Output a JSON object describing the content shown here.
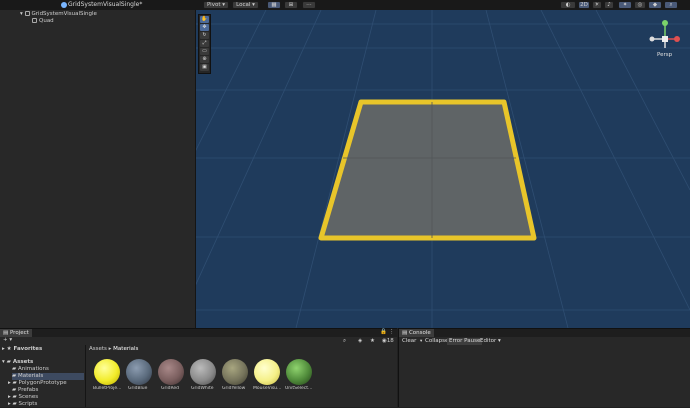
{
  "toolbar": {
    "pivot": "Pivot",
    "local": "Local",
    "mode_2d": "2D",
    "icons": [
      "hand-tool-icon",
      "move-tool-icon",
      "rotate-tool-icon",
      "scale-tool-icon",
      "rect-tool-icon",
      "transform-tool-icon"
    ]
  },
  "hierarchy": {
    "scene_name": "GridSystemVisualSingle*",
    "items": [
      {
        "label": "GridSystemVisualSingle"
      },
      {
        "label": "Quad"
      }
    ]
  },
  "scene": {
    "view_label": "Persp",
    "colors": {
      "background": "#1f3b5c",
      "quad_fill": "#5f6466",
      "quad_border": "#e8c52a"
    }
  },
  "project": {
    "tab": "Project",
    "favorites": "Favorites",
    "assets_root": "Assets",
    "folders": [
      "Animations",
      "Materials",
      "PolygonPrototype",
      "Prefabs",
      "Scenes",
      "Scripts"
    ],
    "breadcrumb": [
      "Assets",
      "Materials"
    ],
    "count": "18",
    "materials": [
      {
        "label": "BulletProje...",
        "color": "#f2ec2a"
      },
      {
        "label": "GridBlue",
        "color": "#5a6a7c"
      },
      {
        "label": "GridRed",
        "color": "#7a5e5e"
      },
      {
        "label": "GridWhite",
        "color": "#8a8a8a"
      },
      {
        "label": "GridYellow",
        "color": "#75735b"
      },
      {
        "label": "MouseVisu...",
        "color": "#f5f088"
      },
      {
        "label": "UnitSelect...",
        "color": "#4f8a3a"
      }
    ]
  },
  "console": {
    "tab": "Console",
    "clear": "Clear",
    "collapse": "Collapse",
    "error_pause": "Error Pause",
    "editor": "Editor"
  }
}
